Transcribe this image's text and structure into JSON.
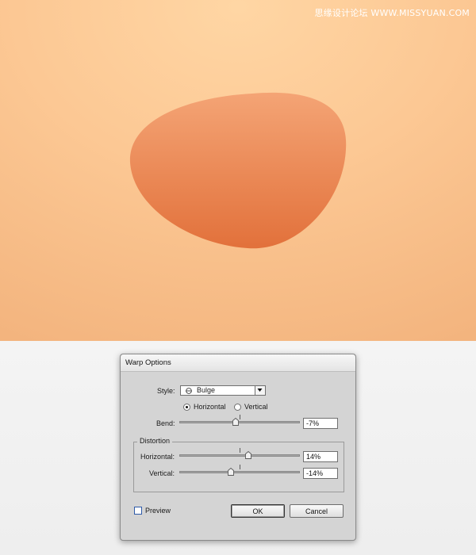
{
  "watermark": "思缘设计论坛 WWW.MISSYUAN.COM",
  "colors": {
    "background_top": "#ffd6a4",
    "background_bottom": "#f3b47e",
    "shape_top": "#f4a475",
    "shape_bottom": "#e2713b",
    "dialog_bg": "#d4d4d4",
    "checkbox_border": "#2e5aa8"
  },
  "dialog": {
    "title": "Warp Options",
    "style": {
      "label": "Style:",
      "value": "Bulge",
      "icon": "bulge-icon",
      "dropdown_icon": "triangle-down-icon"
    },
    "orientation": {
      "options": [
        "Horizontal",
        "Vertical"
      ],
      "selected": "Horizontal"
    },
    "bend": {
      "label": "Bend:",
      "value": "-7%",
      "level": -7
    },
    "distortion": {
      "legend": "Distortion",
      "horizontal": {
        "label": "Horizontal:",
        "value": "14%",
        "level": 14
      },
      "vertical": {
        "label": "Vertical:",
        "value": "-14%",
        "level": -14
      }
    },
    "preview": {
      "label": "Preview",
      "checked": false
    },
    "buttons": {
      "ok": "OK",
      "cancel": "Cancel"
    }
  }
}
